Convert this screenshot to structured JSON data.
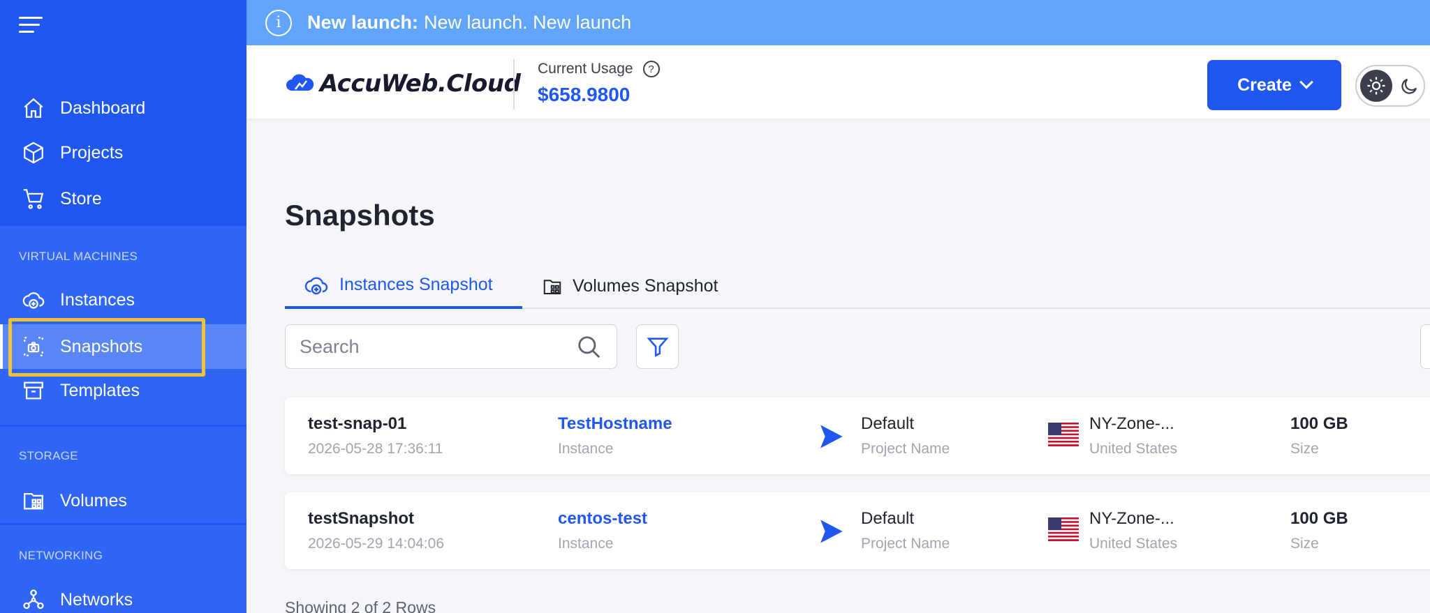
{
  "banner": {
    "title": "New launch:",
    "message": "New launch. New launch"
  },
  "header": {
    "logo_text": "AccuWeb.Cloud",
    "usage_label": "Current Usage",
    "usage_help": "?",
    "usage_value": "$658.9800",
    "create_label": "Create"
  },
  "sidebar": {
    "items_top": [
      {
        "label": "Dashboard",
        "icon": "home-icon"
      },
      {
        "label": "Projects",
        "icon": "cube-icon"
      },
      {
        "label": "Store",
        "icon": "cart-icon"
      }
    ],
    "sections": [
      {
        "label": "VIRTUAL MACHINES",
        "items": [
          {
            "label": "Instances",
            "icon": "cloud-plus-icon"
          },
          {
            "label": "Snapshots",
            "icon": "camera-frame-icon",
            "active": true
          },
          {
            "label": "Templates",
            "icon": "archive-icon"
          }
        ]
      },
      {
        "label": "STORAGE",
        "items": [
          {
            "label": "Volumes",
            "icon": "folder-grid-icon"
          }
        ]
      },
      {
        "label": "NETWORKING",
        "items": [
          {
            "label": "Networks",
            "icon": "network-icon"
          }
        ]
      }
    ]
  },
  "main": {
    "title": "Snapshots",
    "tabs": [
      {
        "label": "Instances Snapshot",
        "active": true
      },
      {
        "label": "Volumes Snapshot",
        "active": false
      }
    ],
    "search_placeholder": "Search",
    "rows": [
      {
        "name": "test-snap-01",
        "date": "2026-05-28 17:36:11",
        "instance": "TestHostname",
        "instance_label": "Instance",
        "project": "Default",
        "project_label": "Project Name",
        "zone": "NY-Zone-...",
        "country": "United States",
        "size": "100 GB",
        "size_label": "Size"
      },
      {
        "name": "testSnapshot",
        "date": "2026-05-29 14:04:06",
        "instance": "centos-test",
        "instance_label": "Instance",
        "project": "Default",
        "project_label": "Project Name",
        "zone": "NY-Zone-...",
        "country": "United States",
        "size": "100 GB",
        "size_label": "Size"
      }
    ],
    "footer": "Showing 2 of 2 Rows"
  },
  "colors": {
    "sidebar": "#1f57f0",
    "section": "#2f66f5",
    "active": "#5b86f7",
    "banner": "#60a5fa",
    "highlight": "#f0c23a",
    "accent": "#1f57f0"
  }
}
